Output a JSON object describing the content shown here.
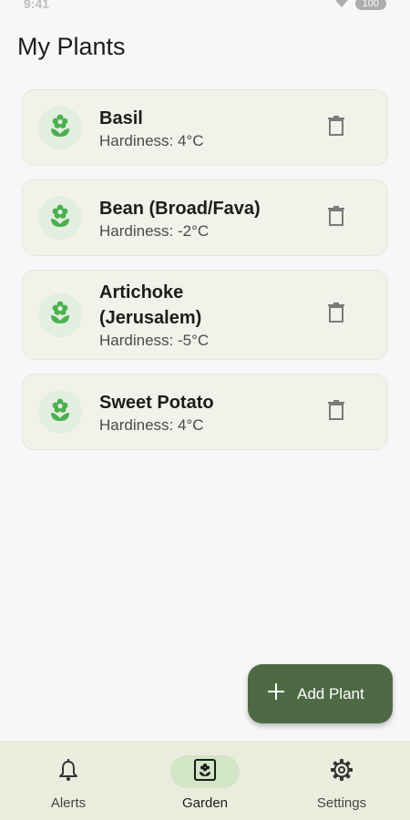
{
  "status_bar": {
    "time": "9:41",
    "battery": "100"
  },
  "header": {
    "title": "My Plants"
  },
  "plants": [
    {
      "name": "Basil",
      "hardiness": "Hardiness: 4°C"
    },
    {
      "name": "Bean (Broad/Fava)",
      "hardiness": "Hardiness: -2°C"
    },
    {
      "name": "Artichoke (Jerusalem)",
      "hardiness": "Hardiness: -5°C"
    },
    {
      "name": "Sweet Potato",
      "hardiness": "Hardiness: 4°C"
    }
  ],
  "fab": {
    "label": "Add Plant",
    "icon": "plus-icon"
  },
  "nav": {
    "items": [
      {
        "label": "Alerts",
        "icon": "bell-icon",
        "active": false
      },
      {
        "label": "Garden",
        "icon": "garden-icon",
        "active": true
      },
      {
        "label": "Settings",
        "icon": "gear-icon",
        "active": false
      }
    ]
  },
  "colors": {
    "accent": "#4e6a45",
    "card_bg": "#f2f2ea",
    "avatar_bg": "#e2eedf",
    "flower_icon": "#4caf50",
    "nav_bg": "#ececde",
    "nav_active_pill": "#d2e5c6"
  }
}
